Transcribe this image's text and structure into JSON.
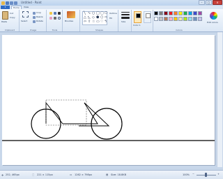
{
  "window": {
    "title": "Untitled - Paint"
  },
  "tabs": {
    "menu": "▾",
    "home": "Home",
    "view": "View"
  },
  "ribbon": {
    "clipboard": {
      "label": "Clipboard",
      "paste": "Paste",
      "cut": "Cut",
      "copy": "Copy"
    },
    "image": {
      "label": "Image",
      "select": "Select",
      "crop": "Crop",
      "resize": "Resize",
      "rotate": "Rotate"
    },
    "tools": {
      "label": "Tools",
      "brushes": "Brushes"
    },
    "shapes": {
      "label": "Shapes",
      "outline": "Outline",
      "fill": "Fill"
    },
    "size": {
      "label": "Size"
    },
    "colors": {
      "label": "Colors",
      "color1": "Color 1",
      "color2": "Color 2",
      "edit": "Edit colors",
      "swatches": [
        "#000000",
        "#7f7f7f",
        "#880015",
        "#ed1c24",
        "#ff7f27",
        "#fff200",
        "#22b14c",
        "#00a2e8",
        "#3f48cc",
        "#a349a4",
        "#ffffff",
        "#c3c3c3",
        "#b97a57",
        "#ffaec9",
        "#ffc90e",
        "#efe4b0",
        "#b5e61d",
        "#99d9ea",
        "#7092be",
        "#c8bfe7"
      ]
    }
  },
  "status": {
    "cursor": "252, 465px",
    "selection": "221 × 115px",
    "image_size": "1262 × 798px",
    "file_size": "Size: 18.8KB",
    "zoom": "100%"
  },
  "icons": {
    "menu": "paint-menu-icon",
    "pencil": "pencil-icon",
    "fill": "fill-icon",
    "eraser": "eraser-icon",
    "picker": "color-picker-icon",
    "magnifier": "magnifier-icon"
  }
}
